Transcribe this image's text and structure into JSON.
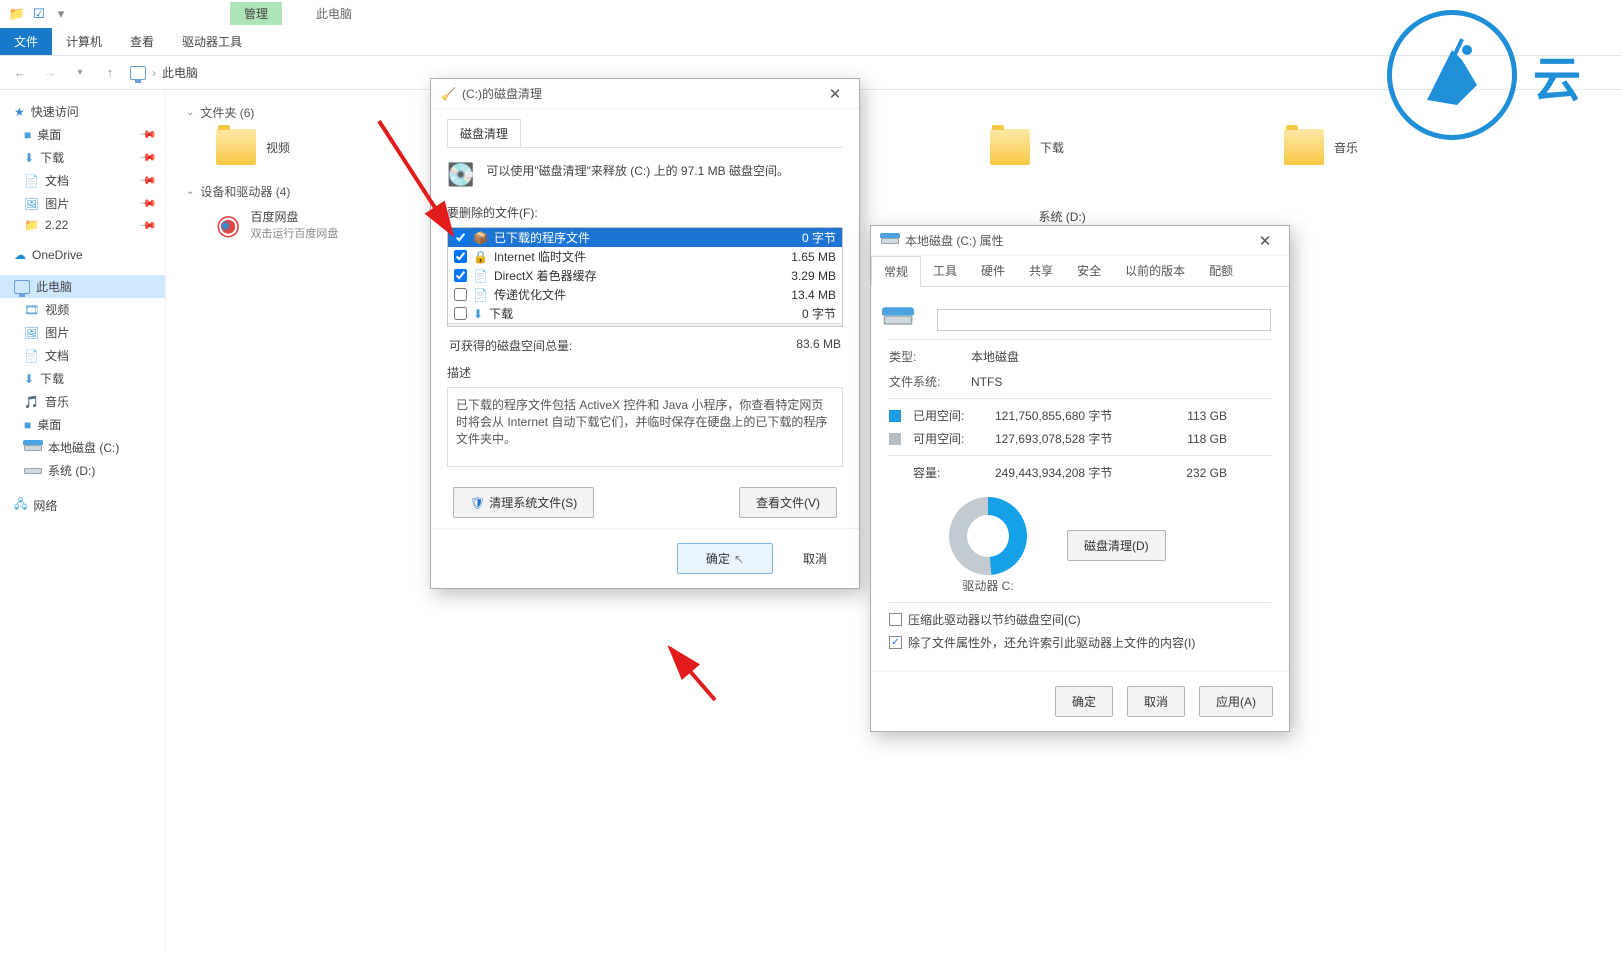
{
  "titlebar": {
    "context_tab": "管理",
    "title": "此电脑"
  },
  "ribbon": {
    "tabs": [
      "文件",
      "计算机",
      "查看",
      "驱动器工具"
    ],
    "active": 0
  },
  "breadcrumb": {
    "location": "此电脑"
  },
  "sidebar": {
    "quick_access": "快速访问",
    "quick_items": [
      {
        "label": "桌面",
        "pinned": true
      },
      {
        "label": "下载",
        "pinned": true
      },
      {
        "label": "文档",
        "pinned": true
      },
      {
        "label": "图片",
        "pinned": true
      },
      {
        "label": "2.22",
        "pinned": true
      }
    ],
    "onedrive": "OneDrive",
    "this_pc": "此电脑",
    "pc_items": [
      "视频",
      "图片",
      "文档",
      "下载",
      "音乐",
      "桌面",
      "本地磁盘 (C:)",
      "系统 (D:)"
    ],
    "network": "网络"
  },
  "content": {
    "folders_header": "文件夹 (6)",
    "folders": [
      "视频",
      "下载",
      "音乐"
    ],
    "devices_header": "设备和驱动器 (4)",
    "baidu": {
      "name": "百度网盘",
      "sub": "双击运行百度网盘"
    },
    "sys_drive": "系统 (D:)"
  },
  "cleanup": {
    "title": "(C:)的磁盘清理",
    "tab": "磁盘清理",
    "intro": "可以使用\"磁盘清理\"来释放  (C:) 上的 97.1 MB 磁盘空间。",
    "list_label": "要删除的文件(F):",
    "files": [
      {
        "checked": true,
        "name": "已下载的程序文件",
        "size": "0 字节",
        "selected": true
      },
      {
        "checked": true,
        "name": "Internet 临时文件",
        "size": "1.65 MB"
      },
      {
        "checked": true,
        "name": "DirectX 着色器缓存",
        "size": "3.29 MB"
      },
      {
        "checked": false,
        "name": "传递优化文件",
        "size": "13.4 MB"
      },
      {
        "checked": false,
        "name": "下载",
        "size": "0 字节"
      }
    ],
    "gain_label": "可获得的磁盘空间总量:",
    "gain_value": "83.6 MB",
    "desc_label": "描述",
    "desc_text": "已下载的程序文件包括 ActiveX 控件和 Java 小程序，你查看特定网页时将会从 Internet 自动下载它们，并临时保存在硬盘上的已下载的程序文件夹中。",
    "btn_sys": "清理系统文件(S)",
    "btn_view": "查看文件(V)",
    "btn_ok": "确定",
    "btn_cancel": "取消"
  },
  "props": {
    "title": "本地磁盘 (C:) 属性",
    "tabs": [
      "常规",
      "工具",
      "硬件",
      "共享",
      "安全",
      "以前的版本",
      "配额"
    ],
    "type_k": "类型:",
    "type_v": "本地磁盘",
    "fs_k": "文件系统:",
    "fs_v": "NTFS",
    "used_k": "已用空间:",
    "used_bytes": "121,750,855,680 字节",
    "used_h": "113 GB",
    "free_k": "可用空间:",
    "free_bytes": "127,693,078,528 字节",
    "free_h": "118 GB",
    "cap_k": "容量:",
    "cap_bytes": "249,443,934,208 字节",
    "cap_h": "232 GB",
    "drive_label": "驱动器 C:",
    "btn_cleanup": "磁盘清理(D)",
    "chk_compress": "压缩此驱动器以节约磁盘空间(C)",
    "chk_index": "除了文件属性外，还允许索引此驱动器上文件的内容(I)",
    "btn_ok": "确定",
    "btn_cancel": "取消",
    "btn_apply": "应用(A)"
  },
  "watermark": "云"
}
